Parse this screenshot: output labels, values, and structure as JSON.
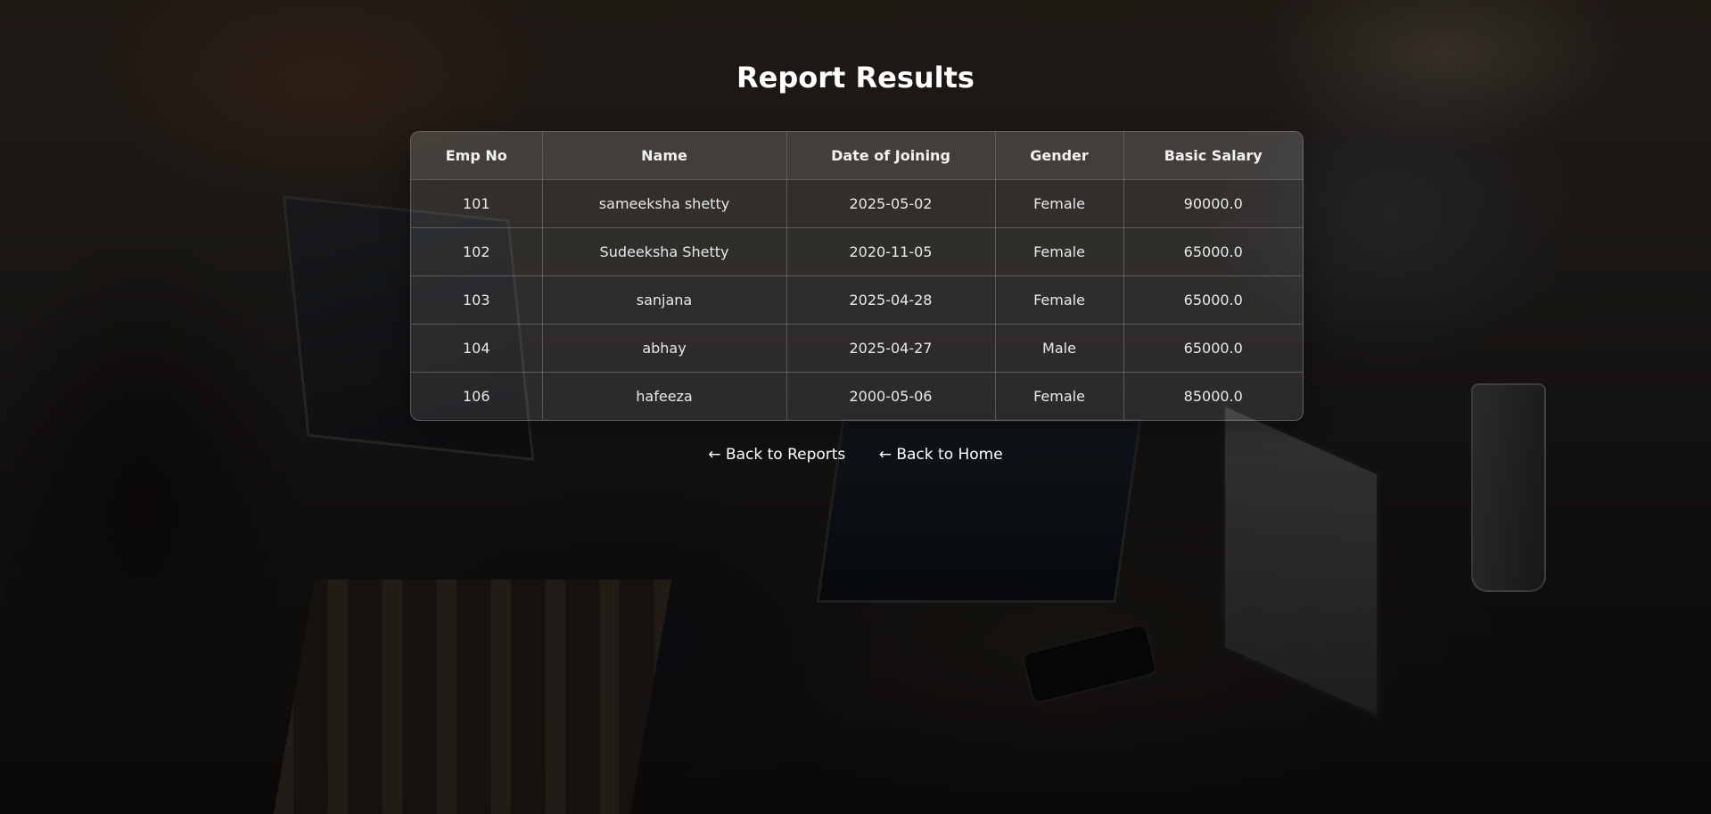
{
  "page": {
    "title": "Report Results"
  },
  "table": {
    "columns": [
      "Emp No",
      "Name",
      "Date of Joining",
      "Gender",
      "Basic Salary"
    ],
    "rows": [
      [
        "101",
        "sameeksha shetty",
        "2025-05-02",
        "Female",
        "90000.0"
      ],
      [
        "102",
        "Sudeeksha Shetty",
        "2020-11-05",
        "Female",
        "65000.0"
      ],
      [
        "103",
        "sanjana",
        "2025-04-28",
        "Female",
        "65000.0"
      ],
      [
        "104",
        "abhay",
        "2025-04-27",
        "Male",
        "65000.0"
      ],
      [
        "106",
        "hafeeza",
        "2000-05-06",
        "Female",
        "85000.0"
      ]
    ]
  },
  "links": {
    "back_to_reports": "← Back to Reports",
    "back_to_home": "← Back to Home"
  }
}
